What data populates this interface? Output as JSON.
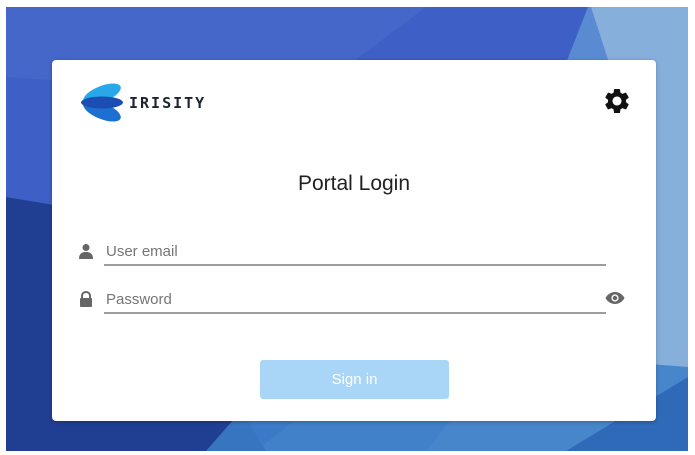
{
  "brand": {
    "name": "IRISITY",
    "logo_icon": "irisity-logo-icon"
  },
  "header": {
    "settings_icon": "gear-icon"
  },
  "login": {
    "title": "Portal Login",
    "email": {
      "icon": "user-icon",
      "placeholder": "User email",
      "value": ""
    },
    "password": {
      "icon": "lock-icon",
      "placeholder": "Password",
      "value": "",
      "toggle_icon": "eye-icon"
    },
    "signin_label": "Sign in"
  },
  "colors": {
    "background_primary": "#3f62c8",
    "background_dark": "#1f3d8f",
    "background_light": "#8ab1dc",
    "signin_button": "#a9d5f6",
    "field_underline": "#9e9e9e",
    "icon": "#666666"
  }
}
